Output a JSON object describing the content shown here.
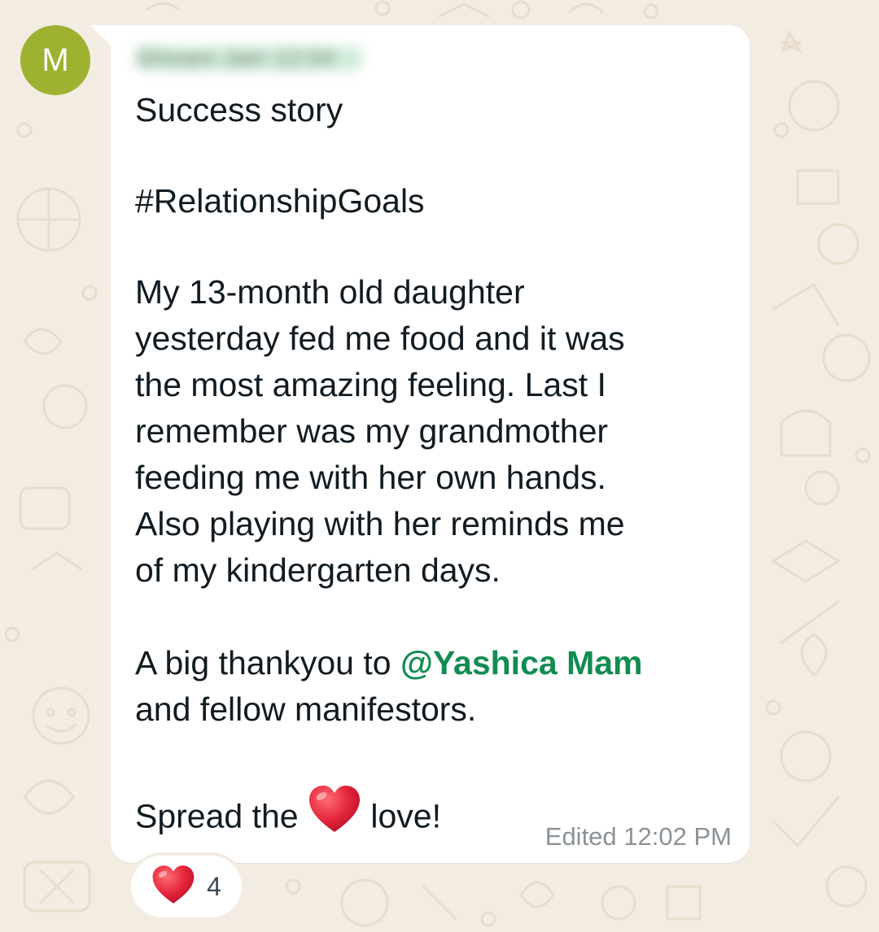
{
  "chat": {
    "avatar_initial": "M",
    "sender": "Shivani Jain 12:04",
    "message": {
      "line_1": "Success story",
      "line_2": "#RelationshipGoals",
      "line_3": "My 13-month old daughter",
      "line_4": "yesterday fed me food and it was",
      "line_5": "the most amazing feeling. Last I",
      "line_6": "remember was my grandmother",
      "line_7": "feeding me with her own hands.",
      "line_8": "Also playing with her reminds me",
      "line_9": "of my kindergarten days.",
      "line_10_before": "A big thankyou to ",
      "mention": "@Yashica Mam",
      "line_11": "and fellow manifestors.",
      "line_12_before": "Spread the ",
      "line_12_after": " love!"
    },
    "meta": {
      "edited_label": "Edited",
      "time": "12:02 PM"
    },
    "reaction": {
      "emoji": "heart-emoji",
      "count": "4"
    }
  },
  "colors": {
    "wallpaper": "#f3ece2",
    "bubble": "#ffffff",
    "avatar": "#9fb130",
    "mention": "#128c51",
    "text": "#111b21",
    "meta": "#8a9297",
    "heart": "#e3253a"
  }
}
